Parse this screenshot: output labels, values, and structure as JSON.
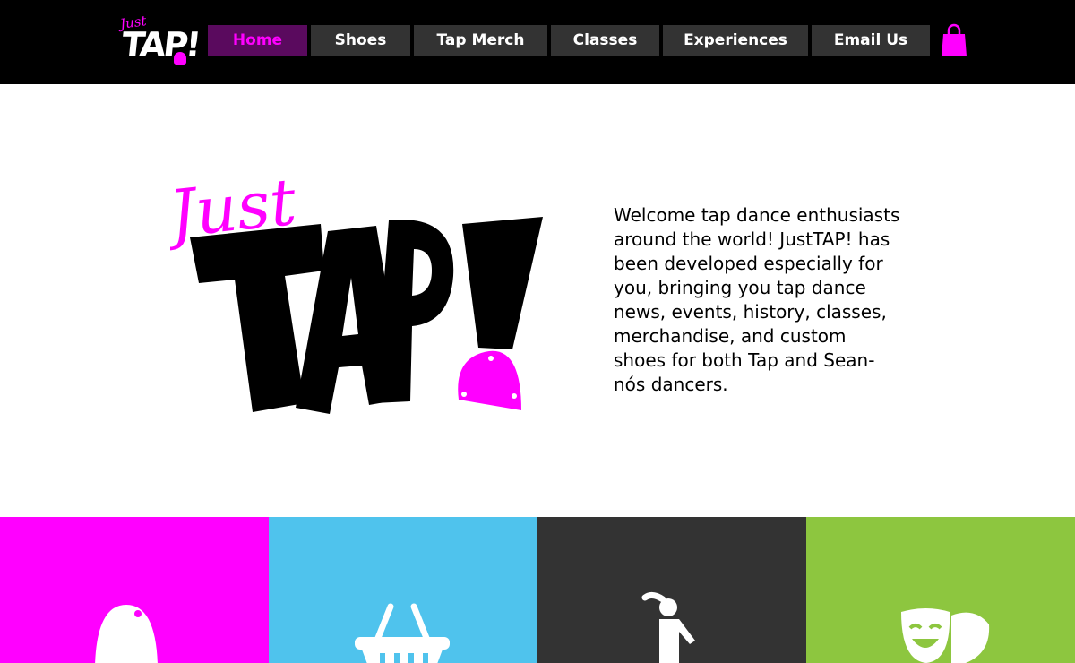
{
  "header": {
    "logo": {
      "just": "Just",
      "tap": "TAP!"
    },
    "nav": [
      {
        "label": "Home",
        "active": true
      },
      {
        "label": "Shoes",
        "active": false
      },
      {
        "label": "Tap Merch",
        "active": false
      },
      {
        "label": "Classes",
        "active": false
      },
      {
        "label": "Experiences",
        "active": false
      },
      {
        "label": "Email Us",
        "active": false
      }
    ],
    "cart_icon": "shopping-bag-icon"
  },
  "hero": {
    "logo": {
      "just": "Just",
      "tap": "TAP!"
    },
    "welcome": "Welcome tap dance enthusiasts around the world! JustTAP! has been developed especially for you, bringing you tap dance news, events, history, classes, merchandise, and custom shoes for both Tap and Sean-nós dancers."
  },
  "tiles": [
    {
      "color": "#ff00ff",
      "icon": "tap-plate-icon"
    },
    {
      "color": "#4fc3ed",
      "icon": "shopping-basket-icon"
    },
    {
      "color": "#333333",
      "icon": "dancer-icon"
    },
    {
      "color": "#8dc63f",
      "icon": "theater-masks-icon"
    }
  ],
  "colors": {
    "accent": "#ff00ff",
    "header_bg": "#000000",
    "nav_bg": "#333333",
    "nav_active_bg": "#5a0a5e"
  }
}
